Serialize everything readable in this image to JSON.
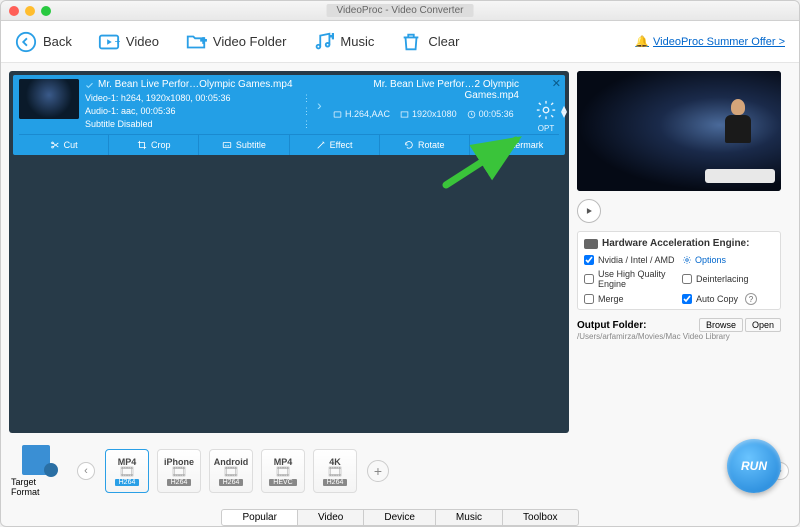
{
  "window": {
    "title": "VideoProc - Video Converter"
  },
  "toolbar": {
    "back": "Back",
    "video": "Video",
    "video_folder": "Video Folder",
    "music": "Music",
    "clear": "Clear",
    "promo": "VideoProc Summer Offer >"
  },
  "video_item": {
    "input_filename": "Mr. Bean Live Perfor…Olympic Games.mp4",
    "video_codec_line": "Video-1: h264, 1920x1080, 00:05:36",
    "audio_codec_line": "Audio-1: aac, 00:05:36",
    "subtitle_line": "Subtitle Disabled",
    "output_filename": "Mr. Bean Live Perfor…2 Olympic Games.mp4",
    "out_codec": "H.264,AAC",
    "out_resolution": "1920x1080",
    "out_duration": "00:05:36",
    "opt_label": "OPT",
    "edit": {
      "cut": "Cut",
      "crop": "Crop",
      "subtitle": "Subtitle",
      "effect": "Effect",
      "rotate": "Rotate",
      "watermark": "Watermark"
    }
  },
  "hw": {
    "title": "Hardware Acceleration Engine:",
    "nvidia_label": "Nvidia / Intel / AMD",
    "options": "Options",
    "hq": "Use High Quality Engine",
    "deint": "Deinterlacing",
    "merge": "Merge",
    "autocopy": "Auto Copy"
  },
  "output": {
    "label": "Output Folder:",
    "path": "/Users/arfamirza/Movies/Mac Video Library",
    "browse": "Browse",
    "open": "Open"
  },
  "formats": {
    "target_label": "Target Format",
    "cards": [
      {
        "top": "MP4",
        "bot": "H264",
        "selected": true
      },
      {
        "top": "iPhone",
        "bot": "H264",
        "selected": false
      },
      {
        "top": "Android",
        "bot": "H264",
        "selected": false
      },
      {
        "top": "MP4",
        "bot": "HEVC",
        "selected": false
      },
      {
        "top": "4K",
        "bot": "H264",
        "selected": false
      }
    ]
  },
  "tabs": {
    "items": [
      "Popular",
      "Video",
      "Device",
      "Music",
      "Toolbox"
    ],
    "selected": 0
  },
  "run": "RUN"
}
